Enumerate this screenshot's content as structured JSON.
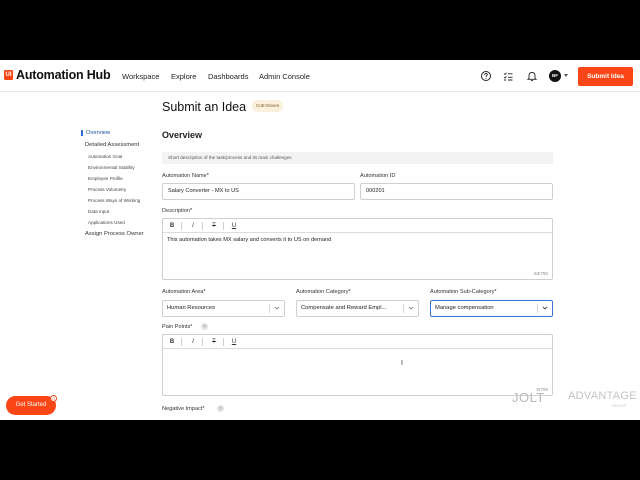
{
  "header": {
    "logo_text": "UI",
    "app_title": "Automation Hub",
    "nav": [
      "Workspace",
      "Explore",
      "Dashboards",
      "Admin Console"
    ],
    "avatar_initials": "BF",
    "submit_label": "Submit Idea",
    "accent_color": "#fa4616"
  },
  "page": {
    "title": "Submit an Idea",
    "badge": "CoE-Driven"
  },
  "sidebar": {
    "items": [
      {
        "label": "Overview",
        "level": "top",
        "active": true
      },
      {
        "label": "Detailed Assessment",
        "level": "top",
        "active": false
      },
      {
        "label": "Automation Goal",
        "level": "sub",
        "active": false
      },
      {
        "label": "Environmental Stability",
        "level": "sub",
        "active": false
      },
      {
        "label": "Employee Profile",
        "level": "sub",
        "active": false
      },
      {
        "label": "Process Volumetry",
        "level": "sub",
        "active": false
      },
      {
        "label": "Process Ways of Working",
        "level": "sub",
        "active": false
      },
      {
        "label": "Data Input",
        "level": "sub",
        "active": false
      },
      {
        "label": "Applications Used",
        "level": "sub",
        "active": false
      },
      {
        "label": "Assign Process Owner",
        "level": "top",
        "active": false
      }
    ]
  },
  "form": {
    "section_title": "Overview",
    "hint": "Short description of the task/process and its main challenges",
    "automation_name": {
      "label": "Automation Name*",
      "value": "Salary Converter - MX to US"
    },
    "automation_id": {
      "label": "Automation ID",
      "value": "000201"
    },
    "description": {
      "label": "Description*",
      "value": "This automation takes MX salary and converts it to US on demand",
      "counter": "63/750"
    },
    "toolbar": {
      "bold": "B",
      "italic": "I",
      "strike": "T",
      "underline": "U"
    },
    "automation_area": {
      "label": "Automation Area*",
      "value": "Human Resources"
    },
    "automation_category": {
      "label": "Automation Category*",
      "value": "Compensate and Reward Empl..."
    },
    "automation_subcategory": {
      "label": "Automation Sub-Category*",
      "value": "Manage compensation"
    },
    "pain_points": {
      "label": "Pain Points*",
      "counter": "0/700"
    },
    "negative_impact": {
      "label": "Negative Impact*"
    },
    "help_glyph": "?"
  },
  "get_started": {
    "label": "Get Started",
    "badge": "0"
  },
  "watermark": {
    "left": "JOLT",
    "right": "ADVANTAGE",
    "sub": "GROUP"
  }
}
